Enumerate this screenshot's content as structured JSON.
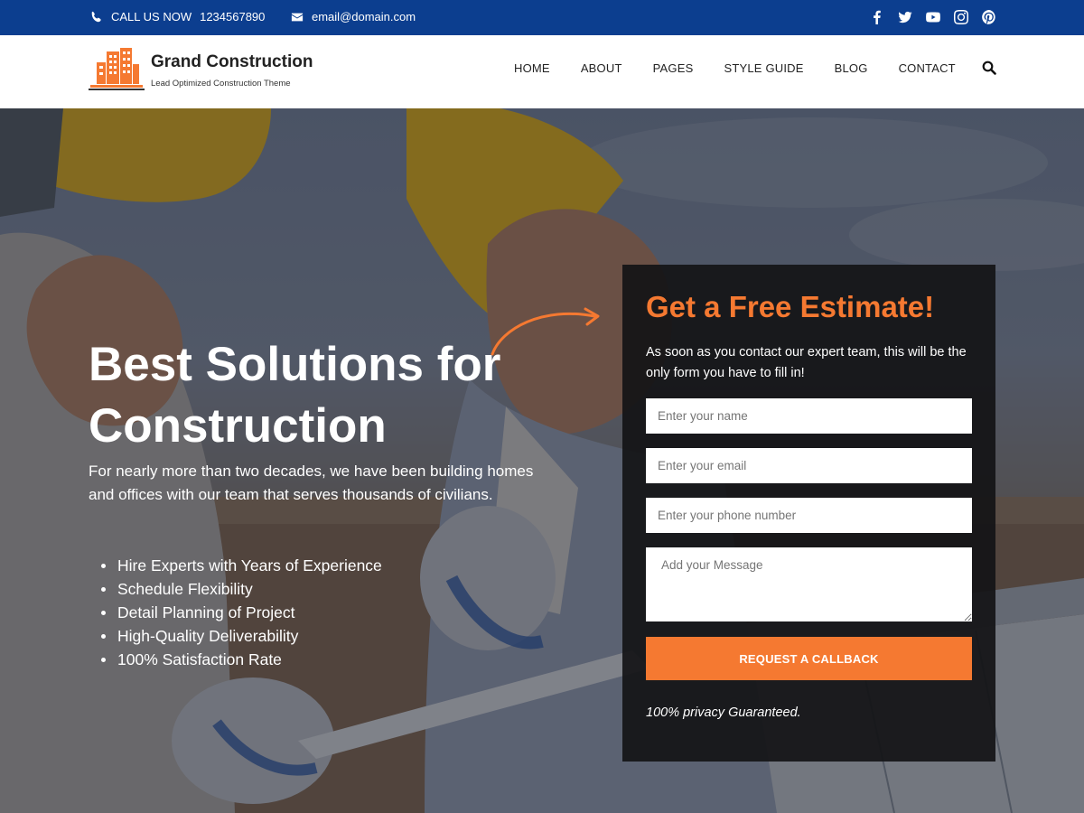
{
  "topbar": {
    "phone_label": "CALL US NOW",
    "phone_number": "1234567890",
    "email": "email@domain.com",
    "social_icons": [
      "facebook-icon",
      "twitter-icon",
      "youtube-icon",
      "instagram-icon",
      "pinterest-icon"
    ]
  },
  "header": {
    "brand_title": "Grand Construction",
    "brand_tagline": "Lead Optimized Construction Theme",
    "nav": [
      "HOME",
      "ABOUT",
      "PAGES",
      "STYLE GUIDE",
      "BLOG",
      "CONTACT"
    ]
  },
  "hero": {
    "headline_line1": "Best Solutions for",
    "headline_line2": "Construction",
    "lead": "For nearly more than two decades, we have been building homes and offices with our team that serves thousands of civilians.",
    "features": [
      "Hire Experts with Years of Experience",
      "Schedule Flexibility",
      "Detail Planning of Project",
      "High-Quality Deliverability",
      "100% Satisfaction Rate"
    ]
  },
  "form": {
    "title": "Get a Free Estimate!",
    "subtitle": "As soon as you contact our expert team, this will be the only form you have to fill in!",
    "name_placeholder": "Enter your name",
    "email_placeholder": "Enter your email",
    "phone_placeholder": "Enter your phone number",
    "message_placeholder": "Add your Message",
    "button_label": "REQUEST A CALLBACK",
    "privacy": "100% privacy Guaranteed."
  },
  "colors": {
    "topbar": "#0c3e8f",
    "accent": "#f57931",
    "panel": "#141416"
  }
}
